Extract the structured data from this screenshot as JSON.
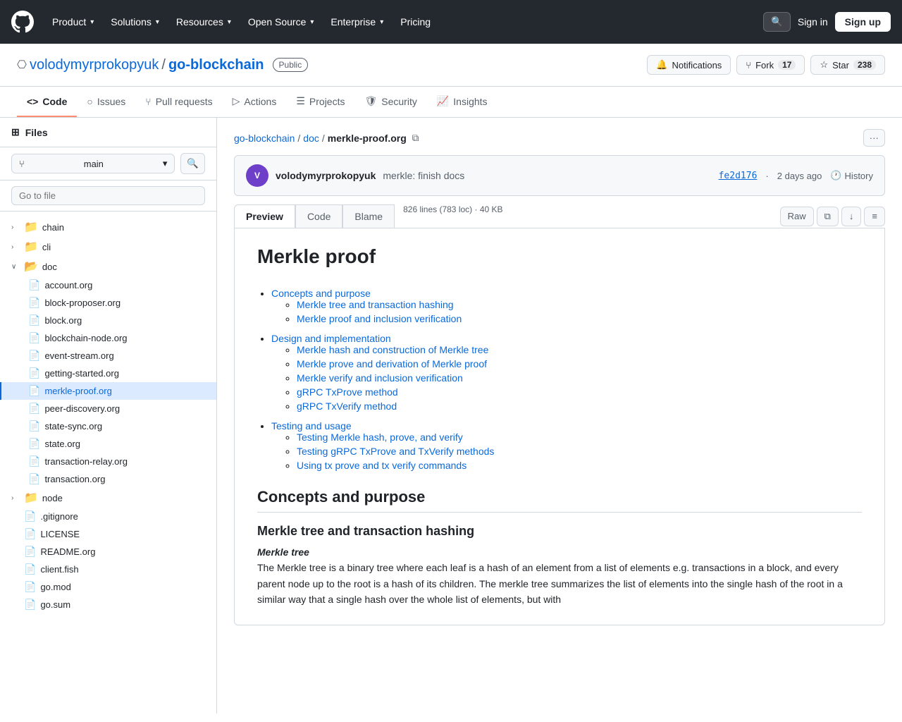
{
  "topNav": {
    "logo": "GitHub",
    "links": [
      {
        "label": "Product",
        "id": "product"
      },
      {
        "label": "Solutions",
        "id": "solutions"
      },
      {
        "label": "Resources",
        "id": "resources"
      },
      {
        "label": "Open Source",
        "id": "open-source"
      },
      {
        "label": "Enterprise",
        "id": "enterprise"
      },
      {
        "label": "Pricing",
        "id": "pricing"
      }
    ],
    "searchPlaceholder": "Search",
    "signinLabel": "Sign in",
    "signupLabel": "Sign up"
  },
  "repoHeader": {
    "owner": "volodymyrprokopyuk",
    "ownerHref": "#",
    "separator": "/",
    "repoName": "go-blockchain",
    "repoHref": "#",
    "visibility": "Public",
    "actions": [
      {
        "id": "notifications",
        "icon": "🔔",
        "label": "Notifications"
      },
      {
        "id": "fork",
        "icon": "⑂",
        "label": "Fork",
        "count": "17"
      },
      {
        "id": "star",
        "icon": "☆",
        "label": "Star",
        "count": "238"
      }
    ]
  },
  "repoTabs": [
    {
      "id": "code",
      "icon": "<>",
      "label": "Code",
      "active": true
    },
    {
      "id": "issues",
      "icon": "○",
      "label": "Issues"
    },
    {
      "id": "pull-requests",
      "icon": "⑂",
      "label": "Pull requests"
    },
    {
      "id": "actions",
      "icon": "▷",
      "label": "Actions"
    },
    {
      "id": "projects",
      "icon": "☰",
      "label": "Projects"
    },
    {
      "id": "security",
      "icon": "🛡",
      "label": "Security"
    },
    {
      "id": "insights",
      "icon": "📈",
      "label": "Insights"
    }
  ],
  "sidebar": {
    "title": "Files",
    "branch": "main",
    "goToFilePlaceholder": "Go to file",
    "tree": [
      {
        "type": "folder",
        "name": "chain",
        "indent": 0,
        "expanded": false,
        "id": "chain"
      },
      {
        "type": "folder",
        "name": "cli",
        "indent": 0,
        "expanded": false,
        "id": "cli"
      },
      {
        "type": "folder",
        "name": "doc",
        "indent": 0,
        "expanded": true,
        "id": "doc"
      },
      {
        "type": "file",
        "name": "account.org",
        "indent": 1,
        "id": "account-org"
      },
      {
        "type": "file",
        "name": "block-proposer.org",
        "indent": 1,
        "id": "block-proposer-org"
      },
      {
        "type": "file",
        "name": "block.org",
        "indent": 1,
        "id": "block-org"
      },
      {
        "type": "file",
        "name": "blockchain-node.org",
        "indent": 1,
        "id": "blockchain-node-org"
      },
      {
        "type": "file",
        "name": "event-stream.org",
        "indent": 1,
        "id": "event-stream-org"
      },
      {
        "type": "file",
        "name": "getting-started.org",
        "indent": 1,
        "id": "getting-started-org"
      },
      {
        "type": "file",
        "name": "merkle-proof.org",
        "indent": 1,
        "id": "merkle-proof-org",
        "active": true
      },
      {
        "type": "file",
        "name": "peer-discovery.org",
        "indent": 1,
        "id": "peer-discovery-org"
      },
      {
        "type": "file",
        "name": "state-sync.org",
        "indent": 1,
        "id": "state-sync-org"
      },
      {
        "type": "file",
        "name": "state.org",
        "indent": 1,
        "id": "state-org"
      },
      {
        "type": "file",
        "name": "transaction-relay.org",
        "indent": 1,
        "id": "transaction-relay-org"
      },
      {
        "type": "file",
        "name": "transaction.org",
        "indent": 1,
        "id": "transaction-org"
      },
      {
        "type": "folder",
        "name": "node",
        "indent": 0,
        "expanded": false,
        "id": "node"
      },
      {
        "type": "file",
        "name": ".gitignore",
        "indent": 0,
        "id": "gitignore"
      },
      {
        "type": "file",
        "name": "LICENSE",
        "indent": 0,
        "id": "license"
      },
      {
        "type": "file",
        "name": "README.org",
        "indent": 0,
        "id": "readme-org"
      },
      {
        "type": "file",
        "name": "client.fish",
        "indent": 0,
        "id": "client-fish"
      },
      {
        "type": "file",
        "name": "go.mod",
        "indent": 0,
        "id": "go-mod"
      },
      {
        "type": "file",
        "name": "go.sum",
        "indent": 0,
        "id": "go-sum"
      }
    ]
  },
  "filePath": {
    "parts": [
      "go-blockchain",
      "doc",
      "merkle-proof.org"
    ],
    "hrefs": [
      "#",
      "#",
      "#"
    ]
  },
  "commit": {
    "authorAvatar": "V",
    "author": "volodymyrprokopyuk",
    "message": "merkle: finish docs",
    "hash": "fe2d176",
    "time": "2 days ago",
    "historyLabel": "History"
  },
  "fileViewTabs": [
    {
      "id": "preview",
      "label": "Preview",
      "active": true
    },
    {
      "id": "code",
      "label": "Code"
    },
    {
      "id": "blame",
      "label": "Blame"
    }
  ],
  "fileMeta": "826 lines (783 loc) · 40 KB",
  "fileActions": [
    {
      "id": "raw",
      "label": "Raw"
    },
    {
      "id": "copy",
      "label": "⧉"
    },
    {
      "id": "download",
      "label": "↓"
    },
    {
      "id": "toc",
      "label": "≡"
    }
  ],
  "docContent": {
    "title": "Merkle proof",
    "toc": {
      "items": [
        {
          "label": "Concepts and purpose",
          "href": "#",
          "sub": [
            {
              "label": "Merkle tree and transaction hashing",
              "href": "#"
            },
            {
              "label": "Merkle proof and inclusion verification",
              "href": "#"
            }
          ]
        },
        {
          "label": "Design and implementation",
          "href": "#",
          "sub": [
            {
              "label": "Merkle hash and construction of Merkle tree",
              "href": "#"
            },
            {
              "label": "Merkle prove and derivation of Merkle proof",
              "href": "#"
            },
            {
              "label": "Merkle verify and inclusion verification",
              "href": "#"
            },
            {
              "label": "gRPC TxProve method",
              "href": "#"
            },
            {
              "label": "gRPC TxVerify method",
              "href": "#"
            }
          ]
        },
        {
          "label": "Testing and usage",
          "href": "#",
          "sub": [
            {
              "label": "Testing Merkle hash, prove, and verify",
              "href": "#"
            },
            {
              "label": "Testing gRPC TxProve and TxVerify methods",
              "href": "#"
            },
            {
              "label": "Using tx prove and tx verify commands",
              "href": "#"
            }
          ]
        }
      ]
    },
    "sections": [
      {
        "id": "concepts-purpose",
        "heading": "Concepts and purpose",
        "subSections": [
          {
            "id": "merkle-tree-hashing",
            "heading": "Merkle tree and transaction hashing",
            "boldLabel": "Merkle tree",
            "body": "The Merkle tree is a binary tree where each leaf is a hash of an element from a list of elements e.g. transactions in a block, and every parent node up to the root is a hash of its children. The merkle tree summarizes the list of elements into the single hash of the root in a similar way that a single hash over the whole list of elements, but with"
          }
        ]
      }
    ]
  }
}
